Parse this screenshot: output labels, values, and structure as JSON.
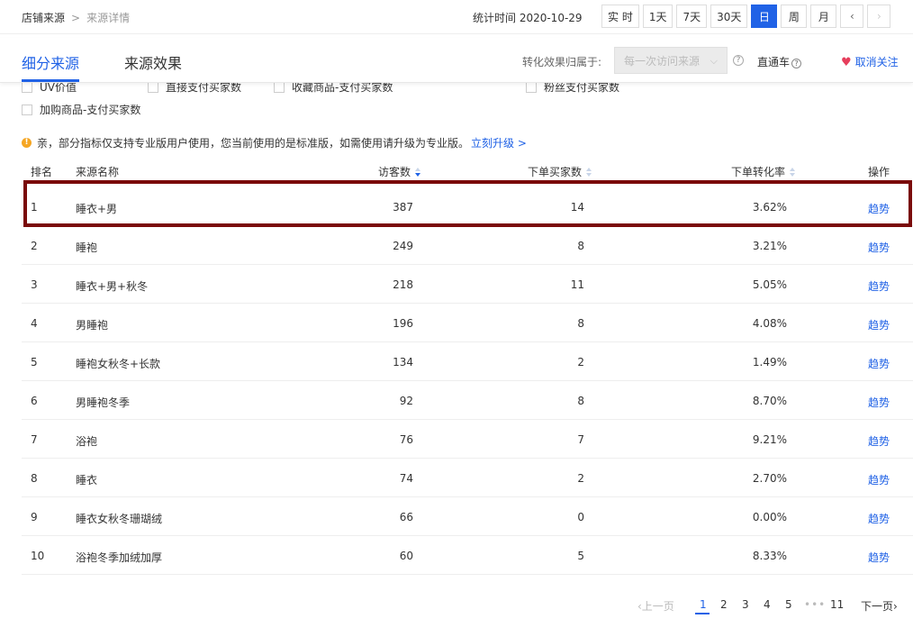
{
  "breadcrumb": {
    "root": "店铺来源",
    "separator": ">",
    "current": "来源详情"
  },
  "stat_time": "统计时间 2020-10-29",
  "periods": [
    {
      "label": "实 时",
      "active": false
    },
    {
      "label": "1天",
      "active": false
    },
    {
      "label": "7天",
      "active": false
    },
    {
      "label": "30天",
      "active": false
    },
    {
      "label": "日",
      "active": true
    },
    {
      "label": "周",
      "active": false
    },
    {
      "label": "月",
      "active": false
    }
  ],
  "period_nav": {
    "prev": "‹",
    "next": "›"
  },
  "tabs": {
    "sub_source": "细分来源",
    "source_effect": "来源效果"
  },
  "attribution": {
    "label": "转化效果归属于:",
    "selected": "每一次访问来源",
    "help": "?"
  },
  "ztc": {
    "label": "直通车",
    "help": "?"
  },
  "unfollow": {
    "label": "取消关注",
    "icon": "heart-icon"
  },
  "checkboxes": {
    "row1": [
      "UV价值",
      "直接支付买家数",
      "收藏商品-支付买家数",
      "粉丝支付买家数"
    ],
    "row2": [
      "加购商品-支付买家数"
    ]
  },
  "notice": {
    "text": "亲，部分指标仅支持专业版用户使用，您当前使用的是标准版，如需使用请升级为专业版。",
    "link": "立刻升级 >"
  },
  "table": {
    "headers": {
      "rank": "排名",
      "name": "来源名称",
      "uv": "访客数",
      "buyers": "下单买家数",
      "rate": "下单转化率",
      "op": "操作"
    },
    "rows": [
      {
        "rank": "1",
        "name": "睡衣+男",
        "uv": "387",
        "buyers": "14",
        "rate": "3.62%",
        "op": "趋势"
      },
      {
        "rank": "2",
        "name": "睡袍",
        "uv": "249",
        "buyers": "8",
        "rate": "3.21%",
        "op": "趋势"
      },
      {
        "rank": "3",
        "name": "睡衣+男+秋冬",
        "uv": "218",
        "buyers": "11",
        "rate": "5.05%",
        "op": "趋势"
      },
      {
        "rank": "4",
        "name": "男睡袍",
        "uv": "196",
        "buyers": "8",
        "rate": "4.08%",
        "op": "趋势"
      },
      {
        "rank": "5",
        "name": "睡袍女秋冬+长款",
        "uv": "134",
        "buyers": "2",
        "rate": "1.49%",
        "op": "趋势"
      },
      {
        "rank": "6",
        "name": "男睡袍冬季",
        "uv": "92",
        "buyers": "8",
        "rate": "8.70%",
        "op": "趋势"
      },
      {
        "rank": "7",
        "name": "浴袍",
        "uv": "76",
        "buyers": "7",
        "rate": "9.21%",
        "op": "趋势"
      },
      {
        "rank": "8",
        "name": "睡衣",
        "uv": "74",
        "buyers": "2",
        "rate": "2.70%",
        "op": "趋势"
      },
      {
        "rank": "9",
        "name": "睡衣女秋冬珊瑚绒",
        "uv": "66",
        "buyers": "0",
        "rate": "0.00%",
        "op": "趋势"
      },
      {
        "rank": "10",
        "name": "浴袍冬季加绒加厚",
        "uv": "60",
        "buyers": "5",
        "rate": "8.33%",
        "op": "趋势"
      }
    ]
  },
  "pagination": {
    "prev": "‹上一页",
    "pages": [
      "1",
      "2",
      "3",
      "4",
      "5"
    ],
    "ellipsis": "•••",
    "last": "11",
    "next": "下一页›",
    "current": "1"
  },
  "colors": {
    "accent": "#2062e6",
    "highlight_border": "#7a0a0a",
    "heart": "#e63e5c",
    "warning": "#f5a623"
  }
}
